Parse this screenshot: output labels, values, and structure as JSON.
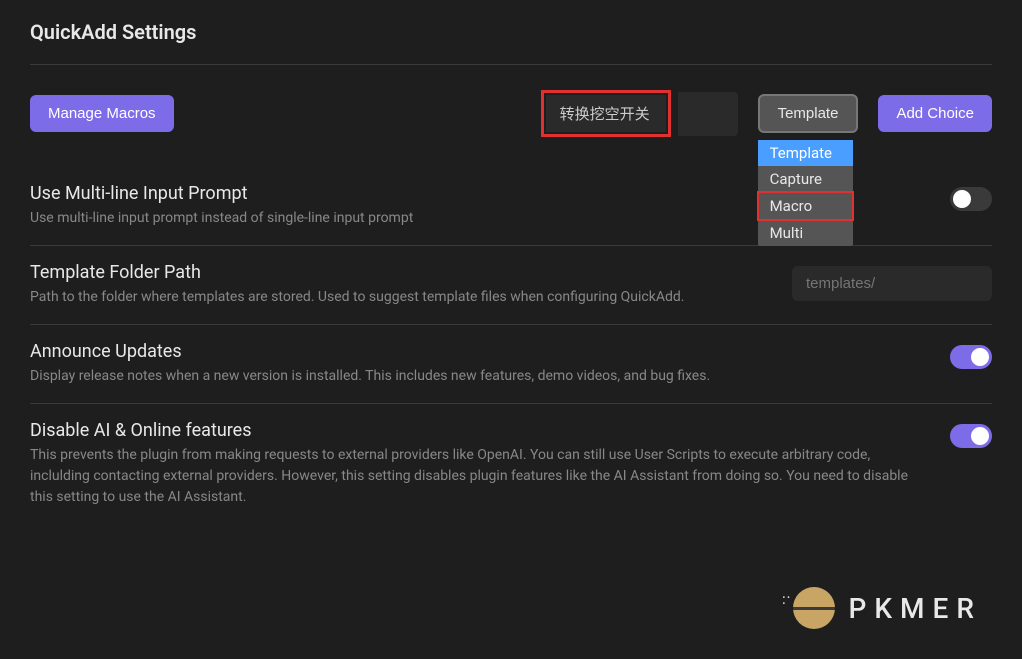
{
  "pageTitle": "QuickAdd Settings",
  "topRow": {
    "manageMacros": "Manage Macros",
    "nameInput": "转换挖空开关",
    "dropdownSelected": "Template",
    "dropdownOptions": [
      "Template",
      "Capture",
      "Macro",
      "Multi"
    ],
    "addChoice": "Add Choice"
  },
  "settings": {
    "multiline": {
      "title": "Use Multi-line Input Prompt",
      "desc": "Use multi-line input prompt instead of single-line input prompt",
      "enabled": false
    },
    "templatePath": {
      "title": "Template Folder Path",
      "desc": "Path to the folder where templates are stored. Used to suggest template files when configuring QuickAdd.",
      "placeholder": "templates/"
    },
    "announce": {
      "title": "Announce Updates",
      "desc": "Display release notes when a new version is installed. This includes new features, demo videos, and bug fixes.",
      "enabled": true
    },
    "disableAI": {
      "title": "Disable AI & Online features",
      "desc": "This prevents the plugin from making requests to external providers like OpenAI. You can still use User Scripts to execute arbitrary code, inclulding contacting external providers. However, this setting disables plugin features like the AI Assistant from doing so. You need to disable this setting to use the AI Assistant.",
      "enabled": true
    }
  },
  "logo": {
    "text": "PKMER"
  }
}
